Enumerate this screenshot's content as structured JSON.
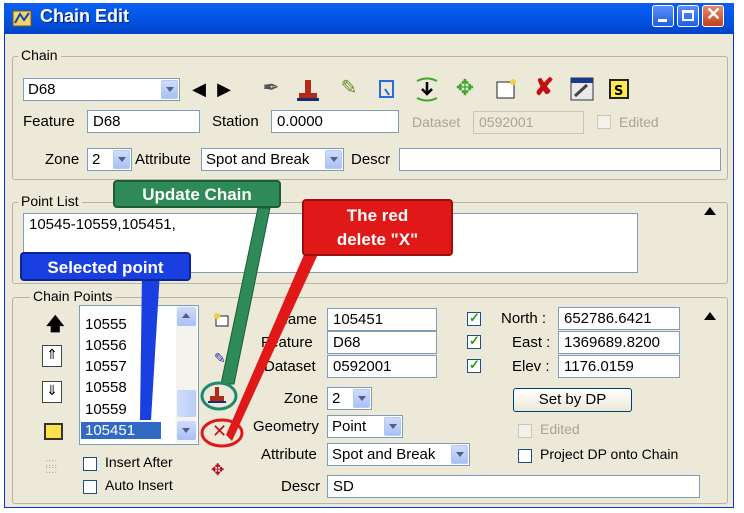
{
  "window": {
    "title": "Chain Edit"
  },
  "chain_group": {
    "legend": "Chain",
    "chain_select": "D68",
    "feature_label": "Feature",
    "feature_value": "D68",
    "station_label": "Station",
    "station_value": "0.0000",
    "dataset_label": "Dataset",
    "dataset_value": "0592001",
    "edited_label": "Edited",
    "zone_label": "Zone",
    "zone_value": "2",
    "attribute_label": "Attribute",
    "attribute_value": "Spot and Break",
    "descr_label": "Descr",
    "descr_value": ""
  },
  "point_list": {
    "legend": "Point List",
    "value": "10545-10559,105451,"
  },
  "chain_points": {
    "legend": "Chain Points",
    "items": [
      "10555",
      "10556",
      "10557",
      "10558",
      "10559",
      "105451"
    ],
    "insert_after_label": "Insert After",
    "auto_insert_label": "Auto Insert",
    "name_label": "Name",
    "name_value": "105451",
    "feature_label": "Feature",
    "feature_value": "D68",
    "dataset_label": "Dataset",
    "dataset_value": "0592001",
    "zone_label": "Zone",
    "zone_value": "2",
    "geometry_label": "Geometry",
    "geometry_value": "Point",
    "attribute_label": "Attribute",
    "attribute_value": "Spot and Break",
    "descr_label": "Descr",
    "descr_value": "SD",
    "north_label": "North :",
    "north_value": "652786.6421",
    "east_label": "East :",
    "east_value": "1369689.8200",
    "elev_label": "Elev :",
    "elev_value": "1176.0159",
    "set_by_dp_label": "Set by DP",
    "edited_label": "Edited",
    "project_dp_label": "Project DP onto Chain"
  },
  "annotations": {
    "update_chain": "Update Chain",
    "red_delete_line1": "The red",
    "red_delete_line2": "delete \"X\"",
    "selected_point": "Selected point"
  },
  "colors": {
    "title_bar": "#0256e8",
    "update_callout": "#2e8b57",
    "delete_callout": "#e01818",
    "selected_callout": "#1a3fe0",
    "selection": "#316ac5"
  }
}
